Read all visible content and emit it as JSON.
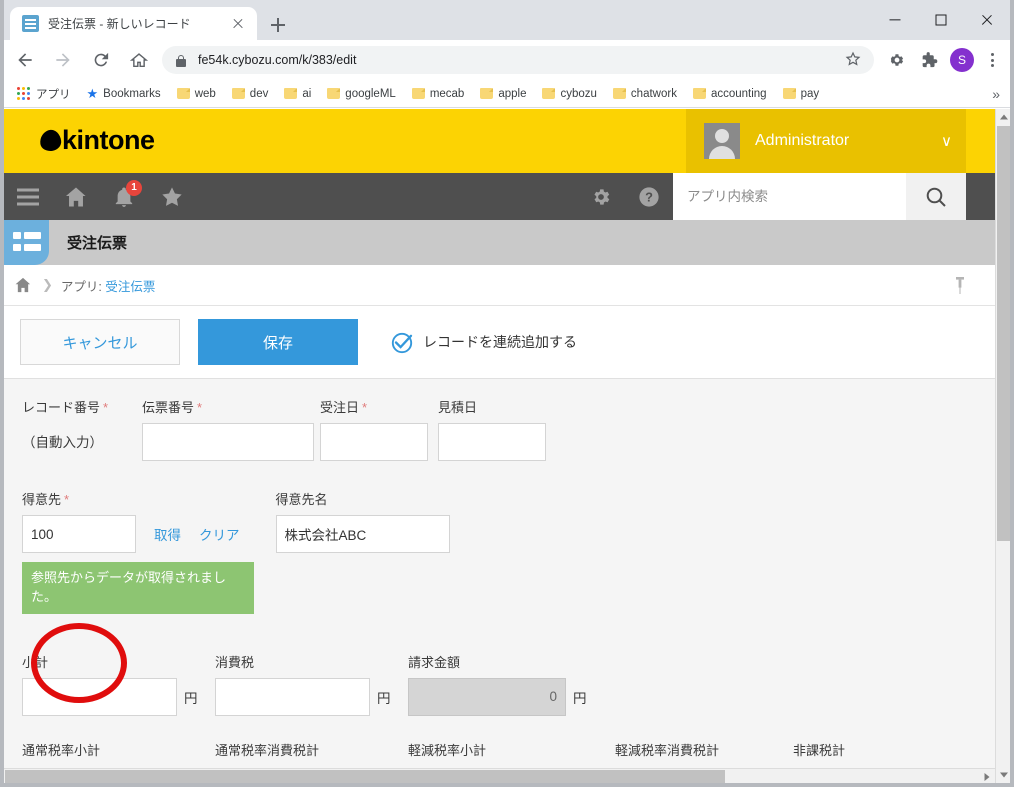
{
  "browser": {
    "tab": {
      "title": "受注伝票 - 新しいレコード",
      "favicon": "kintone-app-icon",
      "close": "×"
    },
    "newtab_tooltip": "新しいタブ",
    "window_controls": {
      "minimize": "—",
      "maximize": "□",
      "close": "×"
    },
    "nav": {
      "back": "back-arrow",
      "forward": "forward-arrow",
      "reload": "reload",
      "home": "home"
    },
    "omnibox": {
      "url": "fe54k.cybozu.com/k/383/edit",
      "lock": "secure-lock",
      "bookmark_star": "☆"
    },
    "toolbar_icons": [
      "gear-extension-icon",
      "puzzle-extensions-icon"
    ],
    "profile_initial": "S",
    "bookmarks": [
      {
        "label": "アプリ",
        "icon": "apps-grid-icon"
      },
      {
        "label": "Bookmarks",
        "icon": "star-icon"
      },
      {
        "label": "web",
        "icon": "folder-icon"
      },
      {
        "label": "dev",
        "icon": "folder-icon"
      },
      {
        "label": "ai",
        "icon": "folder-icon"
      },
      {
        "label": "googleML",
        "icon": "folder-icon"
      },
      {
        "label": "mecab",
        "icon": "folder-icon"
      },
      {
        "label": "apple",
        "icon": "folder-icon"
      },
      {
        "label": "cybozu",
        "icon": "folder-icon"
      },
      {
        "label": "chatwork",
        "icon": "folder-icon"
      },
      {
        "label": "accounting",
        "icon": "folder-icon"
      },
      {
        "label": "pay",
        "icon": "folder-icon"
      }
    ],
    "bookmarks_overflow": "»"
  },
  "kintone": {
    "brand": "kintone",
    "brand_color": "#fcd303",
    "accent_color": "#3498db",
    "user": {
      "name": "Administrator",
      "caret": "∨"
    },
    "nav_icons": [
      {
        "name": "menu-icon",
        "badge": ""
      },
      {
        "name": "home-icon",
        "badge": ""
      },
      {
        "name": "notification-bell-icon",
        "badge": "1"
      },
      {
        "name": "favorites-star-icon",
        "badge": ""
      }
    ],
    "nav_right_icons": [
      "settings-gear-icon",
      "help-icon"
    ],
    "search": {
      "placeholder": "アプリ内検索",
      "value": "",
      "button": "search-icon"
    },
    "app": {
      "title": "受注伝票",
      "icon": "app-list-icon"
    },
    "breadcrumb": {
      "home": "home-icon",
      "prefix": "アプリ:",
      "link": "受注伝票",
      "pin": "pin-icon"
    },
    "actions": {
      "cancel": "キャンセル",
      "save": "保存",
      "continuous_add_label": "レコードを連続追加する",
      "continuous_add_checked": true
    }
  },
  "form": {
    "row1": [
      {
        "label": "レコード番号",
        "required": true,
        "type": "static",
        "value": "（自動入力）"
      },
      {
        "label": "伝票番号",
        "required": true,
        "type": "text",
        "value": ""
      },
      {
        "label": "受注日",
        "required": true,
        "type": "date",
        "value": ""
      },
      {
        "label": "見積日",
        "required": false,
        "type": "date",
        "value": ""
      }
    ],
    "row2": {
      "customer_code": {
        "label": "得意先",
        "required": true,
        "value": "100"
      },
      "lookup_get": "取得",
      "lookup_clear": "クリア",
      "customer_name": {
        "label": "得意先名",
        "required": false,
        "value": "株式会社ABC"
      },
      "message": "参照先からデータが取得されました。",
      "message_color": "#8dc572"
    },
    "row3": [
      {
        "label": "小計",
        "value": "",
        "unit": "円",
        "readonly": false
      },
      {
        "label": "消費税",
        "value": "",
        "unit": "円",
        "readonly": false
      },
      {
        "label": "請求金額",
        "value": "0",
        "unit": "円",
        "readonly": true
      }
    ],
    "row4": [
      {
        "label": "通常税率小計"
      },
      {
        "label": "通常税率消費税計"
      },
      {
        "label": "軽減税率小計"
      },
      {
        "label": "軽減税率消費税計"
      },
      {
        "label": "非課税計"
      }
    ]
  },
  "annotation": {
    "type": "red-circle-highlight",
    "target": "得意先 code input"
  }
}
